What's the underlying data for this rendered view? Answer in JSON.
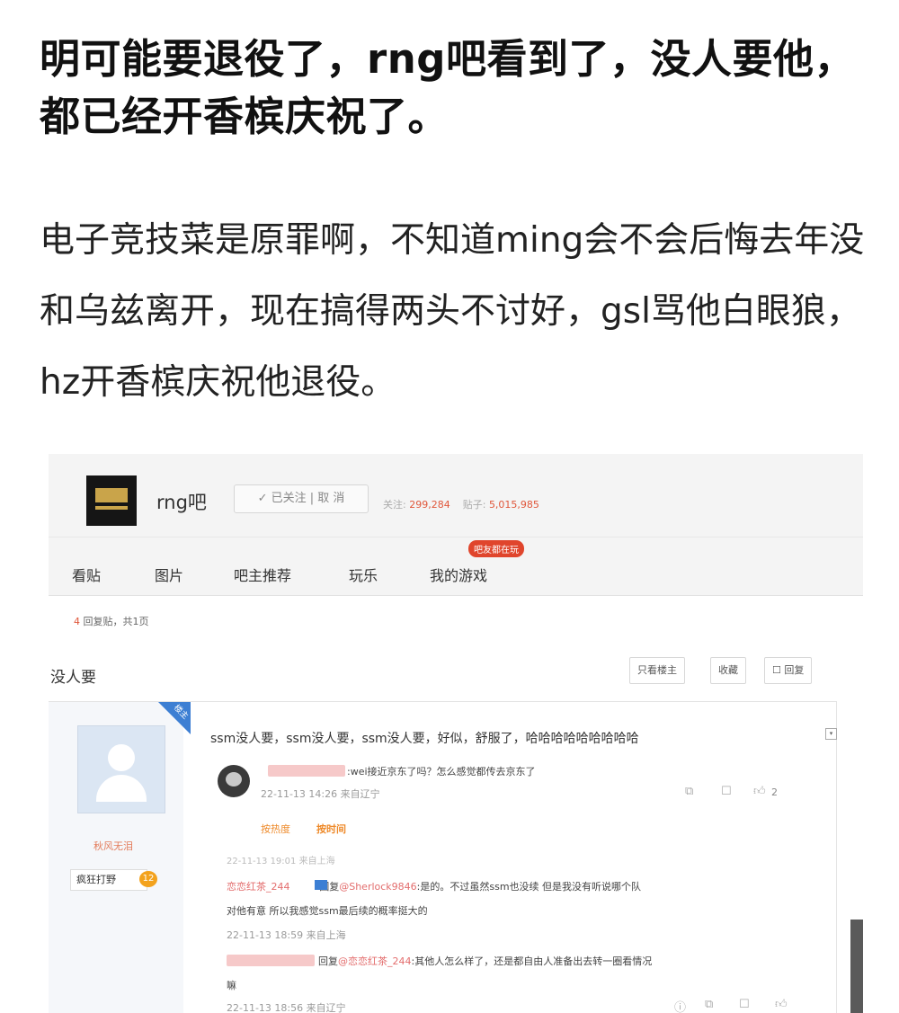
{
  "article": {
    "title": "明可能要退役了，rng吧看到了，没人要他，都已经开香槟庆祝了。",
    "body": "电子竞技菜是原罪啊，不知道ming会不会后悔去年没和乌兹离开，现在搞得两头不讨好，gsl骂他白眼狼，hz开香槟庆祝他退役。"
  },
  "forum": {
    "name": "rng吧",
    "follow_btn": "✓ 已关注 | 取 消",
    "stat_follow_label": "关注:",
    "stat_follow_value": "299,284",
    "stat_posts_label": "贴子:",
    "stat_posts_value": "5,015,985",
    "nav": [
      "看贴",
      "图片",
      "吧主推荐",
      "玩乐",
      "我的游戏"
    ],
    "nav_badge": "吧友都在玩",
    "reply_count_num": "4",
    "reply_count_text": "回复贴，共1页"
  },
  "thread": {
    "title": "没人要",
    "buttons": [
      "只看楼主",
      "收藏",
      "☐ 回复"
    ],
    "author_tag": "楼主",
    "poster_name": "秋风无泪",
    "poster_badge": "疯狂打野",
    "poster_level": "12",
    "main_text": "ssm没人要，ssm没人要，ssm没人要，好似，舒服了，哈哈哈哈哈哈哈哈哈",
    "menu_icon": "▾",
    "replies": [
      {
        "text": ":wei接近京东了吗？怎么感觉都传去京东了",
        "meta": "22-11-13 14:26 来自辽宁",
        "likes": "2"
      }
    ],
    "hot_sort": "按热度",
    "time_sort": "按时间",
    "cut_text": "22-11-13 19:01 来自上海",
    "sub_replies": [
      {
        "user": "恋恋红茶_244",
        "mid": ":回复",
        "mention": "@Sherlock9846",
        "text": ":是的。不过虽然ssm也没续 但是我没有听说哪个队",
        "line2": "对他有意 所以我感觉ssm最后续的概率挺大的",
        "meta": "22-11-13 18:59 来自上海"
      },
      {
        "mid": "回复",
        "mention": "@恋恋红茶_244",
        "text": ":其他人怎么样了，还是都自由人准备出去转一圈看情况",
        "line2": "嘛",
        "meta": "22-11-13 18:56 来自辽宁"
      }
    ]
  },
  "colors": {
    "accent": "#e0573b",
    "blue": "#3d7fd3",
    "level": "#f3a21d"
  }
}
